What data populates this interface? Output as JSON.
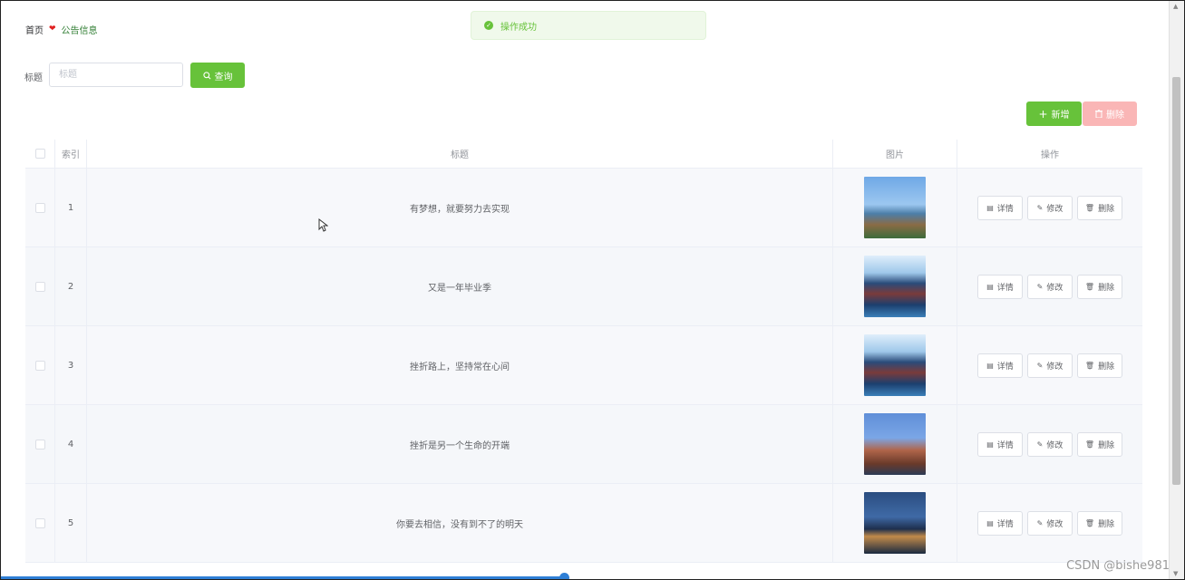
{
  "breadcrumb": {
    "home": "首页",
    "current": "公告信息"
  },
  "toast": {
    "message": "操作成功"
  },
  "search": {
    "label": "标题",
    "placeholder": "标题",
    "value": "",
    "button": "查询"
  },
  "toolbar": {
    "add": "新增",
    "delete": "删除"
  },
  "table": {
    "headers": {
      "index": "索引",
      "title": "标题",
      "image": "图片",
      "ops": "操作"
    },
    "actions": {
      "detail": "详情",
      "edit": "修改",
      "delete": "删除"
    },
    "rows": [
      {
        "index": "1",
        "title": "有梦想，就要努力去实现",
        "image": "burj-al-arab-photo"
      },
      {
        "index": "2",
        "title": "又是一年毕业季",
        "image": "water-town-night-photo"
      },
      {
        "index": "3",
        "title": "挫折路上，坚持常在心间",
        "image": "water-town-night-photo"
      },
      {
        "index": "4",
        "title": "挫折是另一个生命的开端",
        "image": "pagoda-tower-photo"
      },
      {
        "index": "5",
        "title": "你要去相信，没有到不了的明天",
        "image": "river-town-dusk-photo"
      }
    ]
  },
  "watermark": "CSDN @bishe981",
  "colors": {
    "primary": "#67c23a",
    "danger_disabled": "#fab6b6",
    "toast_bg": "#f0f9eb"
  }
}
